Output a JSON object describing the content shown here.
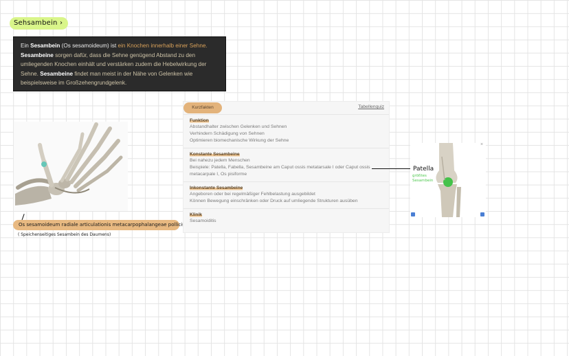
{
  "title": "Sehsambein",
  "title_arrow": "›",
  "definition": {
    "p1": "Ein ",
    "b1": "Sesambein",
    "p2": " (Os sesamoideum) ist ",
    "h1": "ein Knochen innerhalb einer Sehne.",
    "b2": "Sesambeine",
    "p3": " sorgen dafür, dass die Sehne genügend Abstand zu den umliegenden Knochen einhält und verstärken zudem die Hebelwirkung der Sehne. ",
    "b3": "Sesambeine",
    "p4": " findet man meist in der Nähe von Gelenken wie beispielsweise im Großzehengrundgelenk."
  },
  "hand_caption": "Os sesamoideum radiale articulationis metacarpophalangeae pollicis",
  "hand_sub": "( Speichenseitiges Sesambein des Daumens)",
  "facts": {
    "tab": "Kurzfakten",
    "link": "Tabellenquiz",
    "sections": [
      {
        "title": "Funktion",
        "lines": [
          "Abstandhalter zwischen Gelenken und Sehnen",
          "Verhindern Schädigung von Sehnen",
          "Optimieren biomechanische Wirkung der Sehne"
        ]
      },
      {
        "title": "Konstante Sesambeine",
        "lines": [
          "Bei nahezu jedem Menschen",
          "Beispiele: Patella, Fabella, Sesambeine am Caput ossis metatarsale I oder Caput ossis metacarpale I, Os pisiforme"
        ]
      },
      {
        "title": "Inkonstante Sesambeine",
        "lines": [
          "Angeboren oder bei regelmäßiger Fehlbelastung ausgebildet",
          "Können Bewegung einschränken oder Druck auf umliegende Strukturen ausüben"
        ]
      },
      {
        "title": "Klinik",
        "lines": [
          "Sesamoiditis"
        ]
      }
    ]
  },
  "patella_label": "Patella",
  "patella_sub": "größtes Sesambein",
  "colors": {
    "title_highlight": "#d9f58a",
    "caption_highlight": "#e8b981",
    "tab": "#e3b37b",
    "accent_green": "#4fc94f"
  }
}
